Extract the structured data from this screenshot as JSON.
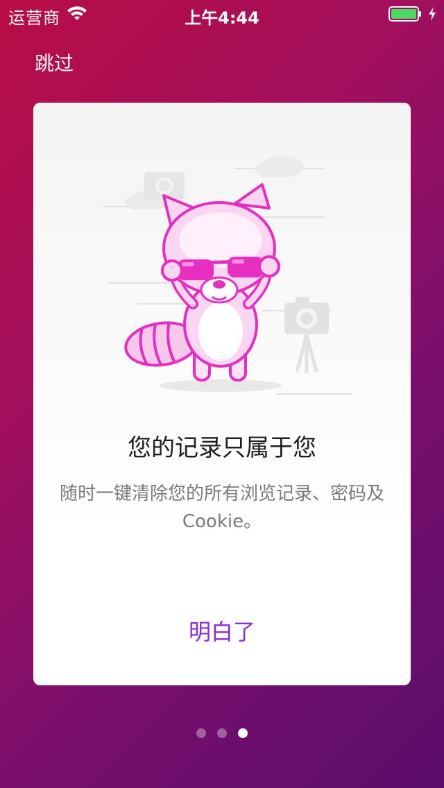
{
  "status_bar": {
    "carrier": "运营商",
    "time": "上午4:44",
    "battery_color": "#4cd964"
  },
  "skip_label": "跳过",
  "card": {
    "title": "您的记录只属于您",
    "description": "随时一键清除您的所有浏览记录、密码及 Cookie。",
    "ok_label": "明白了",
    "accent_color": "#8a2be2",
    "illustration_colors": {
      "primary": "#e62fc0",
      "light": "#fbd6f3"
    }
  },
  "pager": {
    "total": 3,
    "active_index": 2
  }
}
